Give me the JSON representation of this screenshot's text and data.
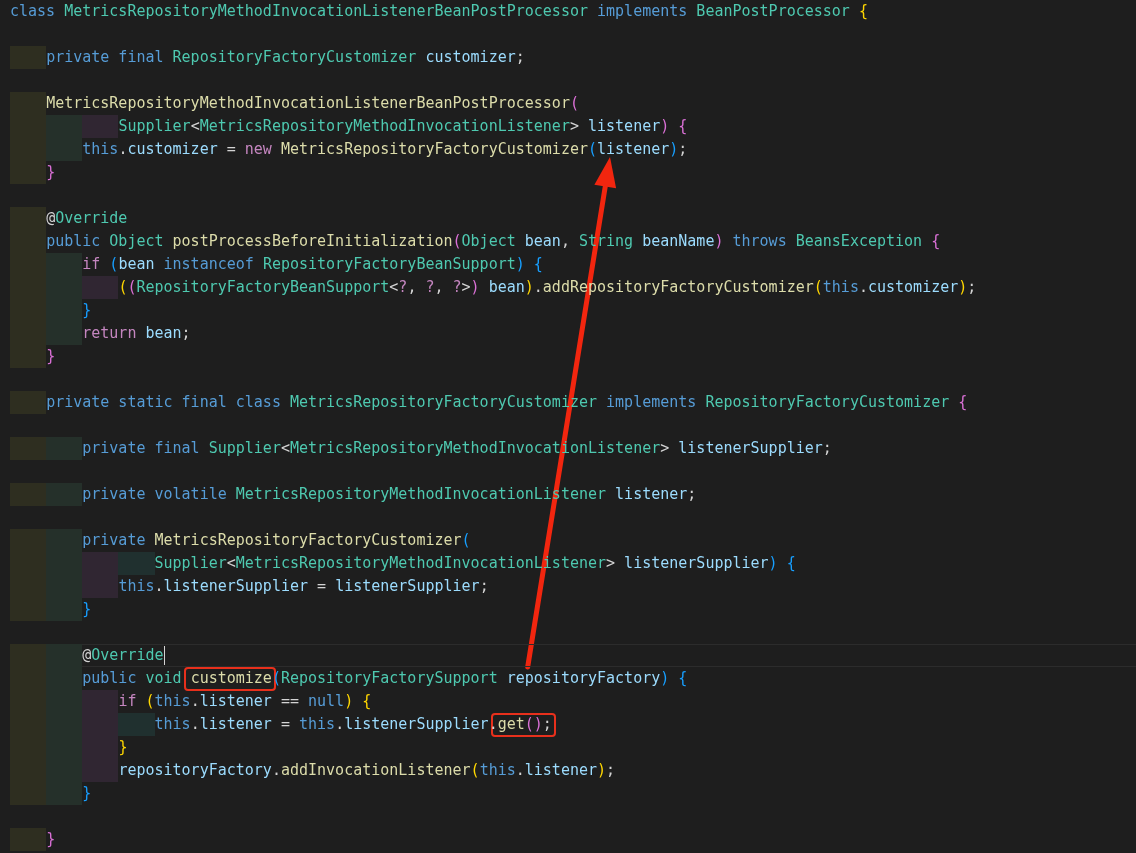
{
  "editor": {
    "lines": [
      {
        "current": false,
        "tokens": [
          {
            "t": "class ",
            "kind": "kw"
          },
          {
            "t": "MetricsRepositoryMethodInvocationListenerBeanPostProcessor ",
            "kind": "type"
          },
          {
            "t": "implements ",
            "kind": "kw"
          },
          {
            "t": "BeanPostProcessor ",
            "kind": "type"
          },
          {
            "t": "{",
            "kind": "b1"
          }
        ]
      },
      {
        "current": false
      },
      {
        "current": false,
        "tokens": [
          {
            "t": "    private final ",
            "kind": "kw"
          },
          {
            "t": "RepositoryFactoryCustomizer ",
            "kind": "type"
          },
          {
            "t": "customizer",
            "kind": "var"
          },
          {
            "t": ";",
            "kind": "p"
          }
        ]
      },
      {
        "current": false
      },
      {
        "current": false,
        "tokens": [
          {
            "t": "    MetricsRepositoryMethodInvocationListenerBeanPostProcessor",
            "kind": "fn"
          },
          {
            "t": "(",
            "kind": "b2"
          }
        ]
      },
      {
        "current": false,
        "tokens": [
          {
            "t": "            Supplier",
            "kind": "type"
          },
          {
            "t": "<",
            "kind": "p"
          },
          {
            "t": "MetricsRepositoryMethodInvocationListener",
            "kind": "type"
          },
          {
            "t": "> ",
            "kind": "p"
          },
          {
            "t": "listener",
            "kind": "var"
          },
          {
            "t": ") {",
            "kind": "b2"
          }
        ]
      },
      {
        "current": false,
        "tokens": [
          {
            "t": "        this",
            "kind": "kw"
          },
          {
            "t": ".",
            "kind": "p"
          },
          {
            "t": "customizer",
            "kind": "var"
          },
          {
            "t": " = ",
            "kind": "p"
          },
          {
            "t": "new ",
            "kind": "ctl"
          },
          {
            "t": "MetricsRepositoryFactoryCustomizer",
            "kind": "fn"
          },
          {
            "t": "(",
            "kind": "b3"
          },
          {
            "t": "listener",
            "kind": "var"
          },
          {
            "t": ")",
            "kind": "b3"
          },
          {
            "t": ";",
            "kind": "p"
          }
        ]
      },
      {
        "current": false,
        "tokens": [
          {
            "t": "    }",
            "kind": "b2"
          }
        ]
      },
      {
        "current": false
      },
      {
        "current": false,
        "tokens": [
          {
            "t": "    @",
            "kind": "p"
          },
          {
            "t": "Override",
            "kind": "type"
          }
        ]
      },
      {
        "current": false,
        "tokens": [
          {
            "t": "    public ",
            "kind": "kw"
          },
          {
            "t": "Object ",
            "kind": "type"
          },
          {
            "t": "postProcessBeforeInitialization",
            "kind": "fn"
          },
          {
            "t": "(",
            "kind": "b2"
          },
          {
            "t": "Object ",
            "kind": "type"
          },
          {
            "t": "bean",
            "kind": "var"
          },
          {
            "t": ", ",
            "kind": "p"
          },
          {
            "t": "String ",
            "kind": "type"
          },
          {
            "t": "beanName",
            "kind": "var"
          },
          {
            "t": ")",
            "kind": "b2"
          },
          {
            "t": " throws ",
            "kind": "kw"
          },
          {
            "t": "BeansException ",
            "kind": "type"
          },
          {
            "t": "{",
            "kind": "b2"
          }
        ]
      },
      {
        "current": false,
        "tokens": [
          {
            "t": "        if ",
            "kind": "ctl"
          },
          {
            "t": "(",
            "kind": "b3"
          },
          {
            "t": "bean ",
            "kind": "var"
          },
          {
            "t": "instanceof ",
            "kind": "kw"
          },
          {
            "t": "RepositoryFactoryBeanSupport",
            "kind": "type"
          },
          {
            "t": ") {",
            "kind": "b3"
          }
        ]
      },
      {
        "current": false,
        "tokens": [
          {
            "t": "            (",
            "kind": "b1"
          },
          {
            "t": "(",
            "kind": "b2"
          },
          {
            "t": "RepositoryFactoryBeanSupport",
            "kind": "type"
          },
          {
            "t": "<",
            "kind": "p"
          },
          {
            "t": "?",
            "kind": "ctl"
          },
          {
            "t": ", ",
            "kind": "p"
          },
          {
            "t": "?",
            "kind": "ctl"
          },
          {
            "t": ", ",
            "kind": "p"
          },
          {
            "t": "?",
            "kind": "ctl"
          },
          {
            "t": ">",
            "kind": "p"
          },
          {
            "t": ")",
            "kind": "b2"
          },
          {
            "t": " bean",
            "kind": "var"
          },
          {
            "t": ")",
            "kind": "b1"
          },
          {
            "t": ".",
            "kind": "p"
          },
          {
            "t": "addRepositoryFactoryCustomizer",
            "kind": "fn"
          },
          {
            "t": "(",
            "kind": "b1"
          },
          {
            "t": "this",
            "kind": "kw"
          },
          {
            "t": ".",
            "kind": "p"
          },
          {
            "t": "customizer",
            "kind": "var"
          },
          {
            "t": ")",
            "kind": "b1"
          },
          {
            "t": ";",
            "kind": "p"
          }
        ]
      },
      {
        "current": false,
        "tokens": [
          {
            "t": "        }",
            "kind": "b3"
          }
        ]
      },
      {
        "current": false,
        "tokens": [
          {
            "t": "        return ",
            "kind": "ctl"
          },
          {
            "t": "bean",
            "kind": "var"
          },
          {
            "t": ";",
            "kind": "p"
          }
        ]
      },
      {
        "current": false,
        "tokens": [
          {
            "t": "    }",
            "kind": "b2"
          }
        ]
      },
      {
        "current": false
      },
      {
        "current": false,
        "tokens": [
          {
            "t": "    private static final class ",
            "kind": "kw"
          },
          {
            "t": "MetricsRepositoryFactoryCustomizer ",
            "kind": "type"
          },
          {
            "t": "implements ",
            "kind": "kw"
          },
          {
            "t": "RepositoryFactoryCustomizer ",
            "kind": "type"
          },
          {
            "t": "{",
            "kind": "b2"
          }
        ]
      },
      {
        "current": false
      },
      {
        "current": false,
        "tokens": [
          {
            "t": "        private final ",
            "kind": "kw"
          },
          {
            "t": "Supplier",
            "kind": "type"
          },
          {
            "t": "<",
            "kind": "p"
          },
          {
            "t": "MetricsRepositoryMethodInvocationListener",
            "kind": "type"
          },
          {
            "t": "> ",
            "kind": "p"
          },
          {
            "t": "listenerSupplier",
            "kind": "var"
          },
          {
            "t": ";",
            "kind": "p"
          }
        ]
      },
      {
        "current": false
      },
      {
        "current": false,
        "tokens": [
          {
            "t": "        private volatile ",
            "kind": "kw"
          },
          {
            "t": "MetricsRepositoryMethodInvocationListener ",
            "kind": "type"
          },
          {
            "t": "listener",
            "kind": "var"
          },
          {
            "t": ";",
            "kind": "p"
          }
        ]
      },
      {
        "current": false
      },
      {
        "current": false,
        "tokens": [
          {
            "t": "        private ",
            "kind": "kw"
          },
          {
            "t": "MetricsRepositoryFactoryCustomizer",
            "kind": "fn"
          },
          {
            "t": "(",
            "kind": "b3"
          }
        ]
      },
      {
        "current": false,
        "tokens": [
          {
            "t": "                Supplier",
            "kind": "type"
          },
          {
            "t": "<",
            "kind": "p"
          },
          {
            "t": "MetricsRepositoryMethodInvocationListener",
            "kind": "type"
          },
          {
            "t": "> ",
            "kind": "p"
          },
          {
            "t": "listenerSupplier",
            "kind": "var"
          },
          {
            "t": ") {",
            "kind": "b3"
          }
        ]
      },
      {
        "current": false,
        "tokens": [
          {
            "t": "            this",
            "kind": "kw"
          },
          {
            "t": ".",
            "kind": "p"
          },
          {
            "t": "listenerSupplier",
            "kind": "var"
          },
          {
            "t": " = ",
            "kind": "p"
          },
          {
            "t": "listenerSupplier",
            "kind": "var"
          },
          {
            "t": ";",
            "kind": "p"
          }
        ]
      },
      {
        "current": false,
        "tokens": [
          {
            "t": "        }",
            "kind": "b3"
          }
        ]
      },
      {
        "current": false
      },
      {
        "current": true,
        "tokens": [
          {
            "t": "        @",
            "kind": "p"
          },
          {
            "t": "Override",
            "kind": "type"
          }
        ]
      },
      {
        "current": false,
        "tokens": [
          {
            "t": "        public ",
            "kind": "kw"
          },
          {
            "t": "void ",
            "kind": "type"
          },
          {
            "t": "customize",
            "kind": "fn",
            "boxed": true
          },
          {
            "t": "(",
            "kind": "b3"
          },
          {
            "t": "RepositoryFactorySupport ",
            "kind": "type"
          },
          {
            "t": "repositoryFactory",
            "kind": "var"
          },
          {
            "t": ") {",
            "kind": "b3"
          }
        ]
      },
      {
        "current": false,
        "tokens": [
          {
            "t": "            if ",
            "kind": "ctl"
          },
          {
            "t": "(",
            "kind": "b1"
          },
          {
            "t": "this",
            "kind": "kw"
          },
          {
            "t": ".",
            "kind": "p"
          },
          {
            "t": "listener",
            "kind": "var"
          },
          {
            "t": " == ",
            "kind": "p"
          },
          {
            "t": "null",
            "kind": "kw"
          },
          {
            "t": ") {",
            "kind": "b1"
          }
        ]
      },
      {
        "current": false,
        "tokens": [
          {
            "t": "                this",
            "kind": "kw"
          },
          {
            "t": ".",
            "kind": "p"
          },
          {
            "t": "listener",
            "kind": "var"
          },
          {
            "t": " = ",
            "kind": "p"
          },
          {
            "t": "this",
            "kind": "kw"
          },
          {
            "t": ".",
            "kind": "p"
          },
          {
            "t": "listenerSupplier",
            "kind": "var"
          },
          {
            "t": ".",
            "kind": "p"
          },
          {
            "t": "get",
            "kind": "fn",
            "boxed": true
          },
          {
            "t": "()",
            "kind": "b2",
            "boxed": true
          },
          {
            "t": ";",
            "kind": "p",
            "boxed": true
          }
        ]
      },
      {
        "current": false,
        "tokens": [
          {
            "t": "            }",
            "kind": "b1"
          }
        ]
      },
      {
        "current": false,
        "tokens": [
          {
            "t": "            repositoryFactory",
            "kind": "var"
          },
          {
            "t": ".",
            "kind": "p"
          },
          {
            "t": "addInvocationListener",
            "kind": "fn"
          },
          {
            "t": "(",
            "kind": "b1"
          },
          {
            "t": "this",
            "kind": "kw"
          },
          {
            "t": ".",
            "kind": "p"
          },
          {
            "t": "listener",
            "kind": "var"
          },
          {
            "t": ")",
            "kind": "b1"
          },
          {
            "t": ";",
            "kind": "p"
          }
        ]
      },
      {
        "current": false,
        "tokens": [
          {
            "t": "        }",
            "kind": "b3"
          }
        ]
      },
      {
        "current": false
      },
      {
        "current": false,
        "tokens": [
          {
            "t": "    }",
            "kind": "b2"
          }
        ]
      }
    ]
  }
}
